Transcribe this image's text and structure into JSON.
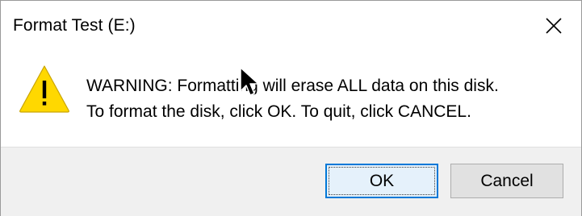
{
  "window": {
    "title": "Format Test (E:)",
    "close_icon": "close-icon"
  },
  "content": {
    "icon": "warning-icon",
    "message_line1": "WARNING: Formatting will erase ALL data on this disk.",
    "message_line2": "To format the disk, click OK. To quit, click CANCEL."
  },
  "buttons": {
    "ok_label": "OK",
    "cancel_label": "Cancel"
  },
  "colors": {
    "warning_yellow": "#ffd800",
    "focus_blue": "#0078d7"
  }
}
